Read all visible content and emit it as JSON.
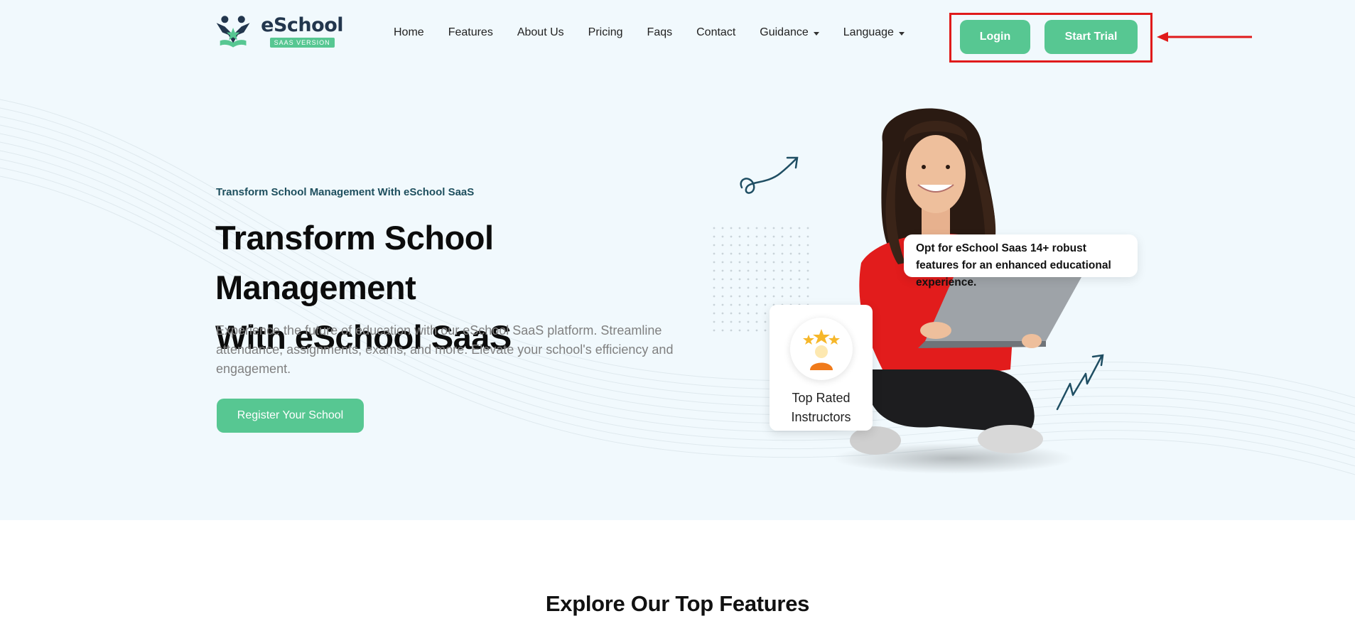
{
  "brand": {
    "name": "eSchool",
    "tagline": "SAAS VERSION",
    "color": "#57c792",
    "dark": "#22364d"
  },
  "nav": {
    "items": [
      {
        "label": "Home"
      },
      {
        "label": "Features"
      },
      {
        "label": "About Us"
      },
      {
        "label": "Pricing"
      },
      {
        "label": "Faqs"
      },
      {
        "label": "Contact"
      },
      {
        "label": "Guidance",
        "dropdown": true
      },
      {
        "label": "Language",
        "dropdown": true
      }
    ],
    "login_label": "Login",
    "trial_label": "Start Trial"
  },
  "annotation": {
    "highlight_color": "#e01b1b",
    "icon": "left-arrow-icon"
  },
  "hero": {
    "eyebrow": "Transform School Management With eSchool SaaS",
    "title_line1": "Transform School Management",
    "title_line2": "With eSchool SaaS",
    "description": "Experience the future of education with our eSchool SaaS platform. Streamline attendance, assignments, exams, and more. Elevate your school's efficiency and engagement.",
    "cta_label": "Register Your School",
    "info_card": "Opt for eSchool Saas 14+ robust features for an enhanced educational experience.",
    "rated_card_line1": "Top Rated",
    "rated_card_line2": "Instructors",
    "rated_icon": "star-award-icon"
  },
  "features": {
    "title": "Explore Our Top Features"
  }
}
